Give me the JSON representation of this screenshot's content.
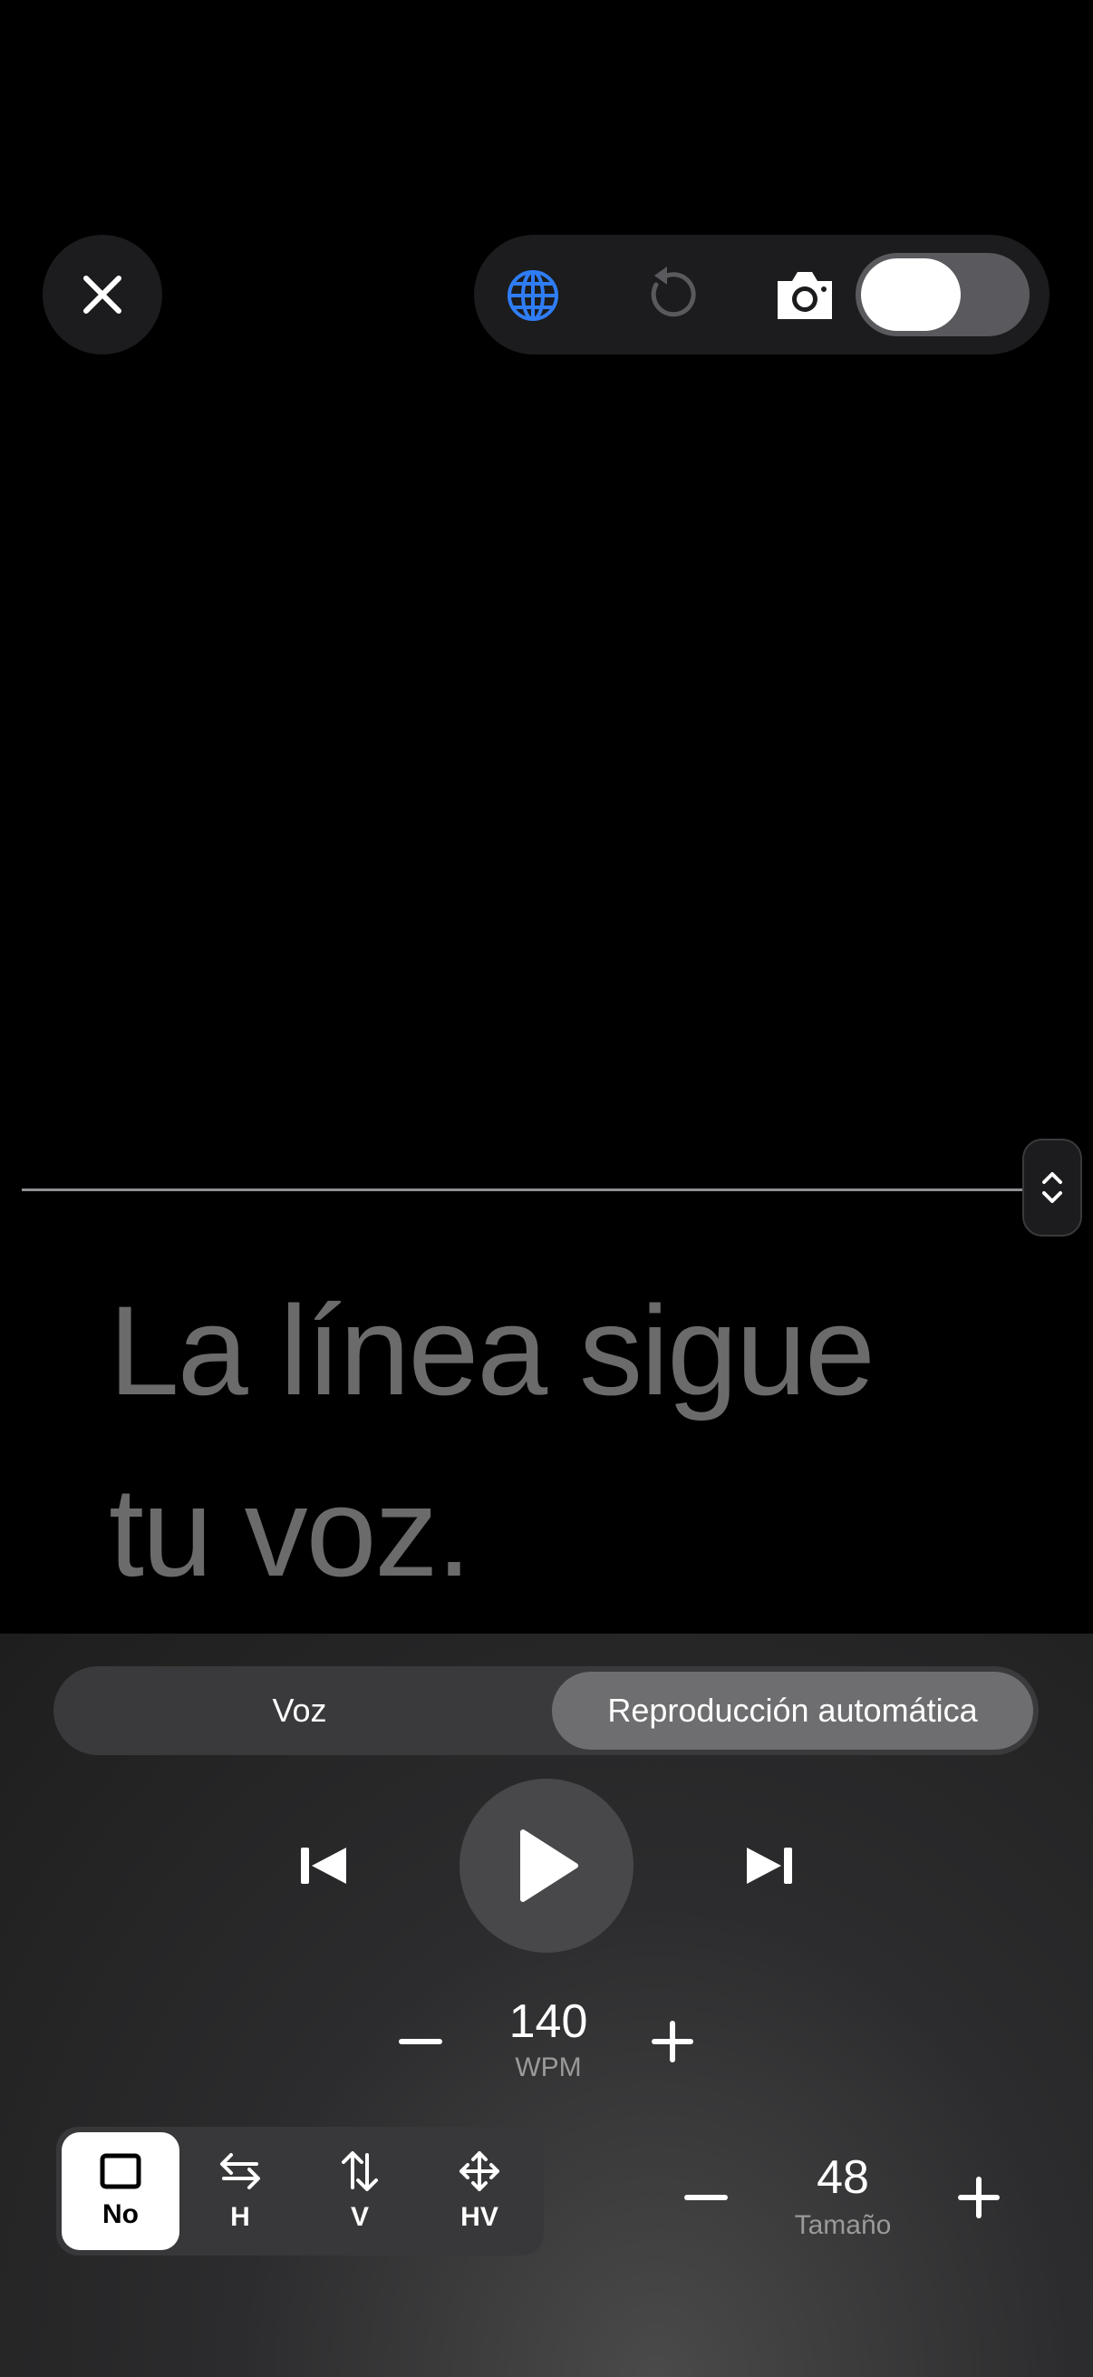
{
  "script_text": {
    "line1": "La línea sigue",
    "line2": "tu voz."
  },
  "top_bar": {
    "icons": [
      "close-icon",
      "globe-icon",
      "reload-icon",
      "camera-icon"
    ],
    "toggle_on": true,
    "accent_color": "#2f7df6"
  },
  "mode": {
    "options": [
      "Voz",
      "Reproducción automática"
    ],
    "selected": "Reproducción automática"
  },
  "playback": {
    "icons": [
      "skip-back-icon",
      "play-icon",
      "skip-forward-icon"
    ]
  },
  "speed": {
    "value": "140",
    "label": "WPM"
  },
  "mirror": {
    "options": [
      {
        "label": "No",
        "icon": "square-icon"
      },
      {
        "label": "H",
        "icon": "horizontal-arrows-icon"
      },
      {
        "label": "V",
        "icon": "vertical-arrows-icon"
      },
      {
        "label": "HV",
        "icon": "move-arrows-icon"
      }
    ],
    "selected": "No"
  },
  "size": {
    "value": "48",
    "label": "Tamaño"
  }
}
